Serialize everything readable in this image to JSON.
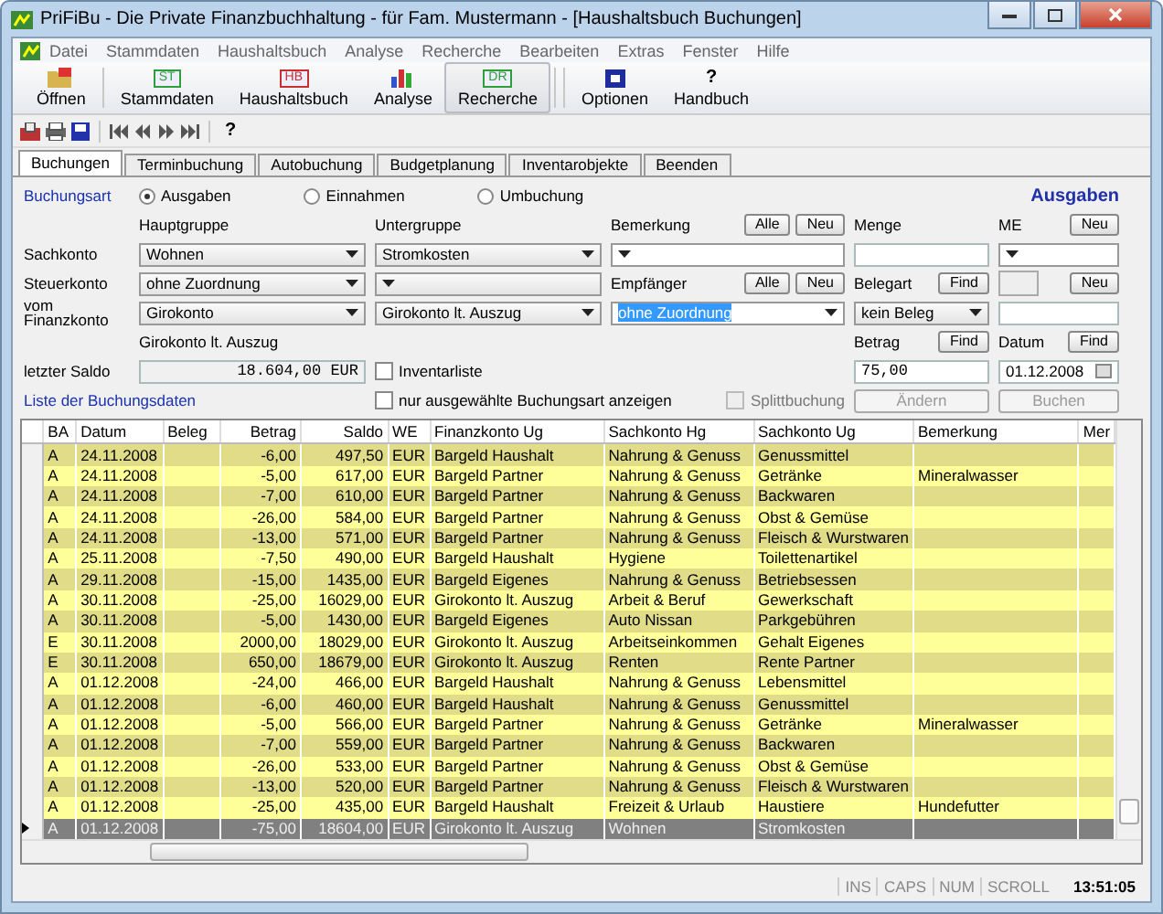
{
  "window": {
    "title": "PriFiBu - Die Private Finanzbuchhaltung -  für Fam. Mustermann - [Haushaltsbuch Buchungen]"
  },
  "menu": [
    "Datei",
    "Stammdaten",
    "Haushaltsbuch",
    "Analyse",
    "Recherche",
    "Bearbeiten",
    "Extras",
    "Fenster",
    "Hilfe"
  ],
  "toolbar": [
    {
      "kind": "open",
      "label": "Öffnen",
      "selected": false
    },
    {
      "kind": "badge",
      "badge": "ST",
      "color": "#2e9e3a",
      "label": "Stammdaten",
      "selected": false
    },
    {
      "kind": "badge",
      "badge": "HB",
      "color": "#c83030",
      "label": "Haushaltsbuch",
      "selected": false
    },
    {
      "kind": "chart",
      "label": "Analyse",
      "selected": false
    },
    {
      "kind": "badge",
      "badge": "DR",
      "color": "#2e9e3a",
      "label": "Recherche",
      "selected": true
    },
    {
      "kind": "options",
      "label": "Optionen",
      "selected": false
    },
    {
      "kind": "help",
      "glyph": "?",
      "label": "Handbuch",
      "selected": false
    }
  ],
  "nav_toolbar": {
    "help": "?"
  },
  "tabs": [
    {
      "label": "Buchungen",
      "selected": true
    },
    {
      "label": "Terminbuchung",
      "selected": false
    },
    {
      "label": "Autobuchung",
      "selected": false
    },
    {
      "label": "Budgetplanung",
      "selected": false
    },
    {
      "label": "Inventarobjekte",
      "selected": false
    },
    {
      "label": "Beenden",
      "selected": false
    }
  ],
  "form": {
    "booking_type": {
      "label": "Buchungsart",
      "options": [
        {
          "label": "Ausgaben",
          "selected": true
        },
        {
          "label": "Einnahmen",
          "selected": false
        },
        {
          "label": "Umbuchung",
          "selected": false
        }
      ]
    },
    "heading": "Ausgaben",
    "main_group_label": "Hauptgruppe",
    "sub_group_label": "Untergruppe",
    "accounts": [
      {
        "label": "Sachkonto",
        "main": "Wohnen",
        "sub": "Stromkosten"
      },
      {
        "label": "Steuerkonto",
        "main": "ohne Zuordnung"
      },
      {
        "label": "vom Finanzkonto",
        "main": "Girokonto",
        "sub": "Girokonto lt. Auszug"
      }
    ],
    "account_caption": "Girokonto lt. Auszug",
    "balance": {
      "label": "letzter Saldo",
      "value": "18.604,00 EUR"
    },
    "inventory": {
      "label": "Inventarliste",
      "checked": false
    },
    "list_label": "Liste der Buchungsdaten",
    "filter": {
      "label": "nur ausgewählte Buchungsart anzeigen",
      "checked": false
    },
    "split": {
      "label": "Splittbuchung",
      "checked": false,
      "disabled": true
    },
    "remark": {
      "label": "Bemerkung",
      "buttons": [
        "Alle",
        "Neu"
      ]
    },
    "payee": {
      "label": "Empfänger",
      "buttons": [
        "Alle",
        "Neu"
      ],
      "value": "ohne Zuordnung",
      "highlighted": true
    },
    "quantity": {
      "label": "Menge"
    },
    "unit": {
      "label": "ME",
      "button": "Neu"
    },
    "receipt_type": {
      "label": "Belegart",
      "find": "Find",
      "new": "Neu",
      "value": "kein Beleg"
    },
    "amount": {
      "label": "Betrag",
      "find": "Find",
      "value": "75,00"
    },
    "date": {
      "label": "Datum",
      "find": "Find",
      "value": "01.12.2008"
    },
    "actions": [
      {
        "label": "Ändern",
        "disabled": true
      },
      {
        "label": "Buchen",
        "disabled": true
      }
    ]
  },
  "table": {
    "columns": [
      "BA",
      "Datum",
      "Beleg",
      "Betrag",
      "Saldo",
      "WE",
      "Finanzkonto Ug",
      "Sachkonto Hg",
      "Sachkonto Ug",
      "Bemerkung",
      "Mer"
    ],
    "rows": [
      {
        "ba": "A",
        "date": "24.11.2008",
        "amount": "-6,00",
        "balance": "497,50",
        "currency": "EUR",
        "account": "Bargeld Haushalt",
        "main": "Nahrung & Genuss",
        "sub": "Genussmittel",
        "selected": false
      },
      {
        "ba": "A",
        "date": "24.11.2008",
        "amount": "-5,00",
        "balance": "617,00",
        "currency": "EUR",
        "account": "Bargeld Partner",
        "main": "Nahrung & Genuss",
        "sub": "Getränke",
        "remark": "Mineralwasser",
        "selected": false
      },
      {
        "ba": "A",
        "date": "24.11.2008",
        "amount": "-7,00",
        "balance": "610,00",
        "currency": "EUR",
        "account": "Bargeld Partner",
        "main": "Nahrung & Genuss",
        "sub": "Backwaren",
        "selected": false
      },
      {
        "ba": "A",
        "date": "24.11.2008",
        "amount": "-26,00",
        "balance": "584,00",
        "currency": "EUR",
        "account": "Bargeld Partner",
        "main": "Nahrung & Genuss",
        "sub": "Obst & Gemüse",
        "selected": false
      },
      {
        "ba": "A",
        "date": "24.11.2008",
        "amount": "-13,00",
        "balance": "571,00",
        "currency": "EUR",
        "account": "Bargeld Partner",
        "main": "Nahrung & Genuss",
        "sub": "Fleisch & Wurstwaren",
        "selected": false
      },
      {
        "ba": "A",
        "date": "25.11.2008",
        "amount": "-7,50",
        "balance": "490,00",
        "currency": "EUR",
        "account": "Bargeld Haushalt",
        "main": "Hygiene",
        "sub": "Toilettenartikel",
        "selected": false
      },
      {
        "ba": "A",
        "date": "29.11.2008",
        "amount": "-15,00",
        "balance": "1435,00",
        "currency": "EUR",
        "account": "Bargeld Eigenes",
        "main": "Nahrung & Genuss",
        "sub": "Betriebsessen",
        "selected": false
      },
      {
        "ba": "A",
        "date": "30.11.2008",
        "amount": "-25,00",
        "balance": "16029,00",
        "currency": "EUR",
        "account": "Girokonto lt. Auszug",
        "main": "Arbeit & Beruf",
        "sub": "Gewerkschaft",
        "selected": false
      },
      {
        "ba": "A",
        "date": "30.11.2008",
        "amount": "-5,00",
        "balance": "1430,00",
        "currency": "EUR",
        "account": "Bargeld Eigenes",
        "main": "Auto Nissan",
        "sub": "Parkgebühren",
        "selected": false
      },
      {
        "ba": "E",
        "date": "30.11.2008",
        "amount": "2000,00",
        "balance": "18029,00",
        "currency": "EUR",
        "account": "Girokonto lt. Auszug",
        "main": "Arbeitseinkommen",
        "sub": "Gehalt Eigenes",
        "selected": false
      },
      {
        "ba": "E",
        "date": "30.11.2008",
        "amount": "650,00",
        "balance": "18679,00",
        "currency": "EUR",
        "account": "Girokonto lt. Auszug",
        "main": "Renten",
        "sub": "Rente Partner",
        "selected": false
      },
      {
        "ba": "A",
        "date": "01.12.2008",
        "amount": "-24,00",
        "balance": "466,00",
        "currency": "EUR",
        "account": "Bargeld Haushalt",
        "main": "Nahrung & Genuss",
        "sub": "Lebensmittel",
        "selected": false
      },
      {
        "ba": "A",
        "date": "01.12.2008",
        "amount": "-6,00",
        "balance": "460,00",
        "currency": "EUR",
        "account": "Bargeld Haushalt",
        "main": "Nahrung & Genuss",
        "sub": "Genussmittel",
        "selected": false
      },
      {
        "ba": "A",
        "date": "01.12.2008",
        "amount": "-5,00",
        "balance": "566,00",
        "currency": "EUR",
        "account": "Bargeld Partner",
        "main": "Nahrung & Genuss",
        "sub": "Getränke",
        "remark": "Mineralwasser",
        "selected": false
      },
      {
        "ba": "A",
        "date": "01.12.2008",
        "amount": "-7,00",
        "balance": "559,00",
        "currency": "EUR",
        "account": "Bargeld Partner",
        "main": "Nahrung & Genuss",
        "sub": "Backwaren",
        "selected": false
      },
      {
        "ba": "A",
        "date": "01.12.2008",
        "amount": "-26,00",
        "balance": "533,00",
        "currency": "EUR",
        "account": "Bargeld Partner",
        "main": "Nahrung & Genuss",
        "sub": "Obst & Gemüse",
        "selected": false
      },
      {
        "ba": "A",
        "date": "01.12.2008",
        "amount": "-13,00",
        "balance": "520,00",
        "currency": "EUR",
        "account": "Bargeld Partner",
        "main": "Nahrung & Genuss",
        "sub": "Fleisch & Wurstwaren",
        "selected": false
      },
      {
        "ba": "A",
        "date": "01.12.2008",
        "amount": "-25,00",
        "balance": "435,00",
        "currency": "EUR",
        "account": "Bargeld Haushalt",
        "main": "Freizeit & Urlaub",
        "sub": "Haustiere",
        "remark": "Hundefutter",
        "selected": false
      },
      {
        "ba": "A",
        "date": "01.12.2008",
        "amount": "-75,00",
        "balance": "18604,00",
        "currency": "EUR",
        "account": "Girokonto lt. Auszug",
        "main": "Wohnen",
        "sub": "Stromkosten",
        "selected": true
      }
    ]
  },
  "status_bar": {
    "indicators": [
      "INS",
      "CAPS",
      "NUM",
      "SCROLL"
    ],
    "time": "13:51:05"
  }
}
